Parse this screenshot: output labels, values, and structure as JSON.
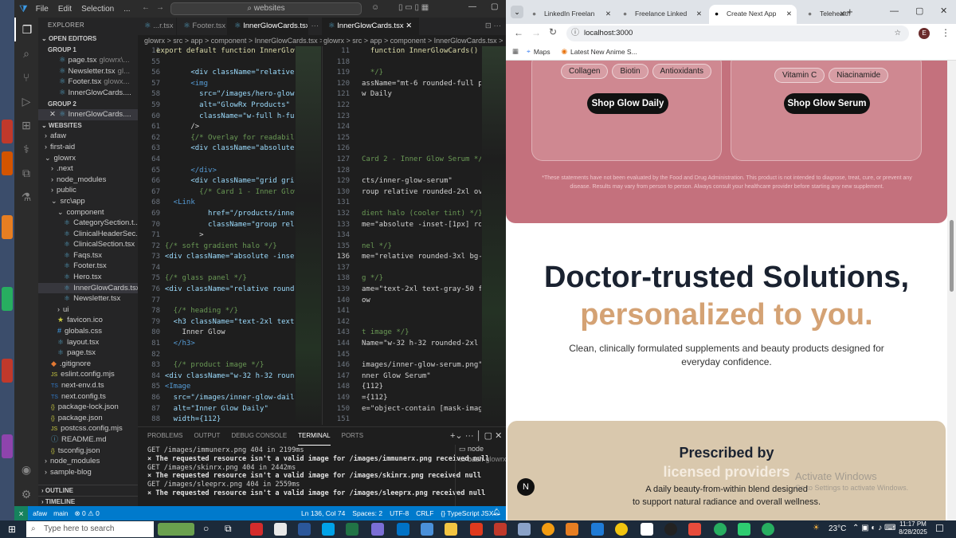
{
  "vscode": {
    "menu": [
      "File",
      "Edit",
      "Selection",
      "..."
    ],
    "command_center": "websites",
    "sidebar_title": "EXPLORER",
    "open_editors_label": "OPEN EDITORS",
    "group1_label": "GROUP 1",
    "group1_files": [
      {
        "name": "page.tsx",
        "hint": "glowrx\\..."
      },
      {
        "name": "Newsletter.tsx",
        "hint": "gl..."
      },
      {
        "name": "Footer.tsx",
        "hint": "glowx..."
      },
      {
        "name": "InnerGlowCards....",
        "hint": ""
      }
    ],
    "group2_label": "GROUP 2",
    "group2_file": "InnerGlowCards....",
    "websites_label": "WEBSITES",
    "tree": [
      {
        "name": "afaw",
        "indent": 1,
        "type": "folder"
      },
      {
        "name": "first-aid",
        "indent": 1,
        "type": "folder"
      },
      {
        "name": "glowrx",
        "indent": 1,
        "type": "folder-open"
      },
      {
        "name": ".next",
        "indent": 2,
        "type": "folder"
      },
      {
        "name": "node_modules",
        "indent": 2,
        "type": "folder"
      },
      {
        "name": "public",
        "indent": 2,
        "type": "folder"
      },
      {
        "name": "src\\app",
        "indent": 2,
        "type": "folder-open"
      },
      {
        "name": "component",
        "indent": 3,
        "type": "folder-open"
      },
      {
        "name": "CategorySection.t...",
        "indent": 4,
        "type": "tsx"
      },
      {
        "name": "ClinicalHeaderSec...",
        "indent": 4,
        "type": "tsx"
      },
      {
        "name": "ClinicalSection.tsx",
        "indent": 4,
        "type": "tsx"
      },
      {
        "name": "Faqs.tsx",
        "indent": 4,
        "type": "tsx"
      },
      {
        "name": "Footer.tsx",
        "indent": 4,
        "type": "tsx"
      },
      {
        "name": "Hero.tsx",
        "indent": 4,
        "type": "tsx"
      },
      {
        "name": "InnerGlowCards.tsx",
        "indent": 4,
        "type": "tsx",
        "selected": true
      },
      {
        "name": "Newsletter.tsx",
        "indent": 4,
        "type": "tsx"
      },
      {
        "name": "ui",
        "indent": 3,
        "type": "folder"
      },
      {
        "name": "favicon.ico",
        "indent": 3,
        "type": "star"
      },
      {
        "name": "globals.css",
        "indent": 3,
        "type": "css"
      },
      {
        "name": "layout.tsx",
        "indent": 3,
        "type": "tsx"
      },
      {
        "name": "page.tsx",
        "indent": 3,
        "type": "tsx"
      },
      {
        "name": ".gitignore",
        "indent": 2,
        "type": "git"
      },
      {
        "name": "eslint.config.mjs",
        "indent": 2,
        "type": "js"
      },
      {
        "name": "next-env.d.ts",
        "indent": 2,
        "type": "ts"
      },
      {
        "name": "next.config.ts",
        "indent": 2,
        "type": "ts"
      },
      {
        "name": "package-lock.json",
        "indent": 2,
        "type": "json"
      },
      {
        "name": "package.json",
        "indent": 2,
        "type": "json"
      },
      {
        "name": "postcss.config.mjs",
        "indent": 2,
        "type": "js"
      },
      {
        "name": "README.md",
        "indent": 2,
        "type": "info"
      },
      {
        "name": "tsconfig.json",
        "indent": 2,
        "type": "json"
      },
      {
        "name": "node_modules",
        "indent": 1,
        "type": "folder"
      },
      {
        "name": "sample-blog",
        "indent": 1,
        "type": "folder"
      }
    ],
    "outline_label": "OUTLINE",
    "timeline_label": "TIMELINE",
    "left_tabs": [
      "...r.tsx",
      "Footer.tsx",
      "InnerGlowCards.tsx"
    ],
    "right_tab": "InnerGlowCards.tsx",
    "left_breadcrumb": "glowrx > src > app > component > InnerGlowCards.tsx >",
    "right_breadcrumb": "glowrx > src > app > component > InnerGlowCards.tsx >",
    "left_line_numbers": [
      "11",
      "55",
      "56",
      "57",
      "58",
      "59",
      "60",
      "61",
      "62",
      "63",
      "64",
      "65",
      "66",
      "67",
      "68",
      "69",
      "70",
      "71",
      "72",
      "73",
      "74",
      "75",
      "76",
      "77",
      "78",
      "79",
      "80",
      "81",
      "82",
      "83",
      "84",
      "85",
      "86",
      "87",
      "88",
      "89",
      "90",
      "91",
      "92",
      "93"
    ],
    "left_code": [
      "export default function InnerGlowC",
      "",
      "        <div className=\"relative w",
      "        <img",
      "          src=\"/images/hero-glowrx",
      "          alt=\"GlowRx Products\"",
      "          className=\"w-full h-full",
      "        />",
      "        {/* Overlay for readabilit",
      "        <div className=\"absolute i",
      "",
      "        </div>",
      "        <div className=\"grid grid-",
      "          {/* Card 1 - Inner Glow",
      "    <Link",
      "            href=\"/products/inner-",
      "            className=\"group relat",
      "          >",
      "  {/* soft gradient halo */}",
      "  <div className=\"absolute -inset-",
      "",
      "  {/* glass panel */}",
      "  <div className=\"relative rounded",
      "",
      "    {/* heading */}",
      "    <h3 className=\"text-2xl text-g",
      "      Inner Glow",
      "    </h3>",
      "",
      "    {/* product image */}",
      "  <div className=\"w-32 h-32 rounde",
      "  <Image",
      "    src=\"/images/inner-glow-daily.",
      "    alt=\"Inner Glow Daily\"",
      "    width={112}",
      "    height={112}",
      "    className=\"object-contain [mas",
      "    />",
      "  </div>",
      ""
    ],
    "right_line_numbers": [
      "11",
      "118",
      "119",
      "120",
      "121",
      "122",
      "123",
      "124",
      "125",
      "126",
      "127",
      "128",
      "129",
      "130",
      "131",
      "132",
      "133",
      "134",
      "135",
      "136",
      "137",
      "138",
      "139",
      "140",
      "141",
      "142",
      "143",
      "144",
      "145",
      "146",
      "147",
      "148",
      "149",
      "150",
      "151",
      "152",
      "153",
      "154",
      "155",
      "156"
    ],
    "right_code": [
      "  function InnerGlowCards() {",
      "",
      "  */}",
      "assName=\"mt-6 rounded-full px-5 py",
      "w Daily",
      "",
      "",
      "",
      "",
      "",
      "Card 2 - Inner Glow Serum */}",
      "",
      "cts/inner-glow-serum\"",
      "roup relative rounded-2xl overflow",
      "",
      "dient halo (cooler tint) */}",
      "me=\"absolute -inset-[1px] rounded-",
      "",
      "nel */}",
      "me=\"relative rounded-3xl bg-white/",
      "",
      "g */}",
      "ame=\"text-2xl text-gray-50 font-se",
      "ow",
      "",
      "",
      "t image */}",
      "Name=\"w-32 h-32 rounded-2xl flex i",
      "",
      "images/inner-glow-serum.png\"",
      "nner Glow Serum\"",
      "{112}",
      "={112}",
      "e=\"object-contain [mask-image:line",
      "",
      "",
      "=\"text-2xl font-semibold mb-4\">",
      "assName=\"text-[#7D6FA3]\">Serum</sp",
      "",
      "t */}"
    ],
    "panel_tabs": [
      "PROBLEMS",
      "OUTPUT",
      "DEBUG CONSOLE",
      "TERMINAL",
      "PORTS"
    ],
    "active_panel_tab": "TERMINAL",
    "terminal_lines": [
      {
        "text": "GET /images/immunerx.png 404 in 2199ms",
        "kind": "get"
      },
      {
        "text": "⨯ The requested resource isn't a valid image for /images/immunerx.png received null",
        "kind": "err"
      },
      {
        "text": "GET /images/skinrx.png 404 in 2442ms",
        "kind": "get"
      },
      {
        "text": "⨯ The requested resource isn't a valid image for /images/skinrx.png received null",
        "kind": "err"
      },
      {
        "text": "GET /images/sleeprx.png 404 in 2559ms",
        "kind": "get"
      },
      {
        "text": "⨯ The requested resource isn't a valid image for /images/sleeprx.png received null",
        "kind": "err"
      }
    ],
    "terminal_list": [
      {
        "label": "node",
        "hint": ""
      },
      {
        "label": "bash",
        "hint": "glowrx"
      }
    ],
    "status_left": [
      "afaw",
      "main",
      "⊗ 0 ⚠ 0"
    ],
    "status_right": [
      "Ln 136, Col 74",
      "Spaces: 2",
      "UTF-8",
      "CRLF",
      "{} TypeScript JSX"
    ],
    "accent": "#007acc"
  },
  "browser": {
    "tabs": [
      {
        "title": "LinkedIn Freelan",
        "active": false
      },
      {
        "title": "Freelance Linked",
        "active": false
      },
      {
        "title": "Create Next App",
        "active": true
      },
      {
        "title": "Telehealth for a",
        "active": false
      }
    ],
    "new_tab": "+",
    "url": "localhost:3000",
    "profile_initial": "E",
    "bookmarks": [
      "Maps",
      "Latest New Anime S..."
    ],
    "page": {
      "left_pills": [
        "Collagen",
        "Biotin",
        "Antioxidants"
      ],
      "right_pills": [
        "Vitamin C",
        "Niacinamide"
      ],
      "left_button": "Shop Glow Daily",
      "right_button": "Shop Glow Serum",
      "disclaimer": "*These statements have not been evaluated by the Food and Drug Administration. This product is not intended to diagnose, treat, cure, or prevent any disease. Results may vary from person to person. Always consult your healthcare provider before starting any new supplement.",
      "headline_line1": "Doctor-trusted Solutions,",
      "headline_line2": "personalized to you.",
      "subtext": "Clean, clinically formulated supplements and beauty products designed for everyday confidence.",
      "prescribed_line1": "Prescribed by",
      "prescribed_line2": "licensed providers",
      "prescribed_desc_line1": "A daily beauty-from-within blend designed",
      "prescribed_desc_line2": "to support natural radiance and overall wellness.",
      "watermark_title": "Activate Windows",
      "watermark_sub": "Go to Settings to activate Windows.",
      "nextjs_badge": "N",
      "colors": {
        "rose": "#c4717d",
        "gold": "#d4a274",
        "navy": "#1a2230",
        "beige": "#d9c8ad"
      }
    }
  },
  "taskbar": {
    "search_placeholder": "Type here to search",
    "weather": "23°C",
    "time": "11:17 PM",
    "date": "8/28/2025"
  }
}
